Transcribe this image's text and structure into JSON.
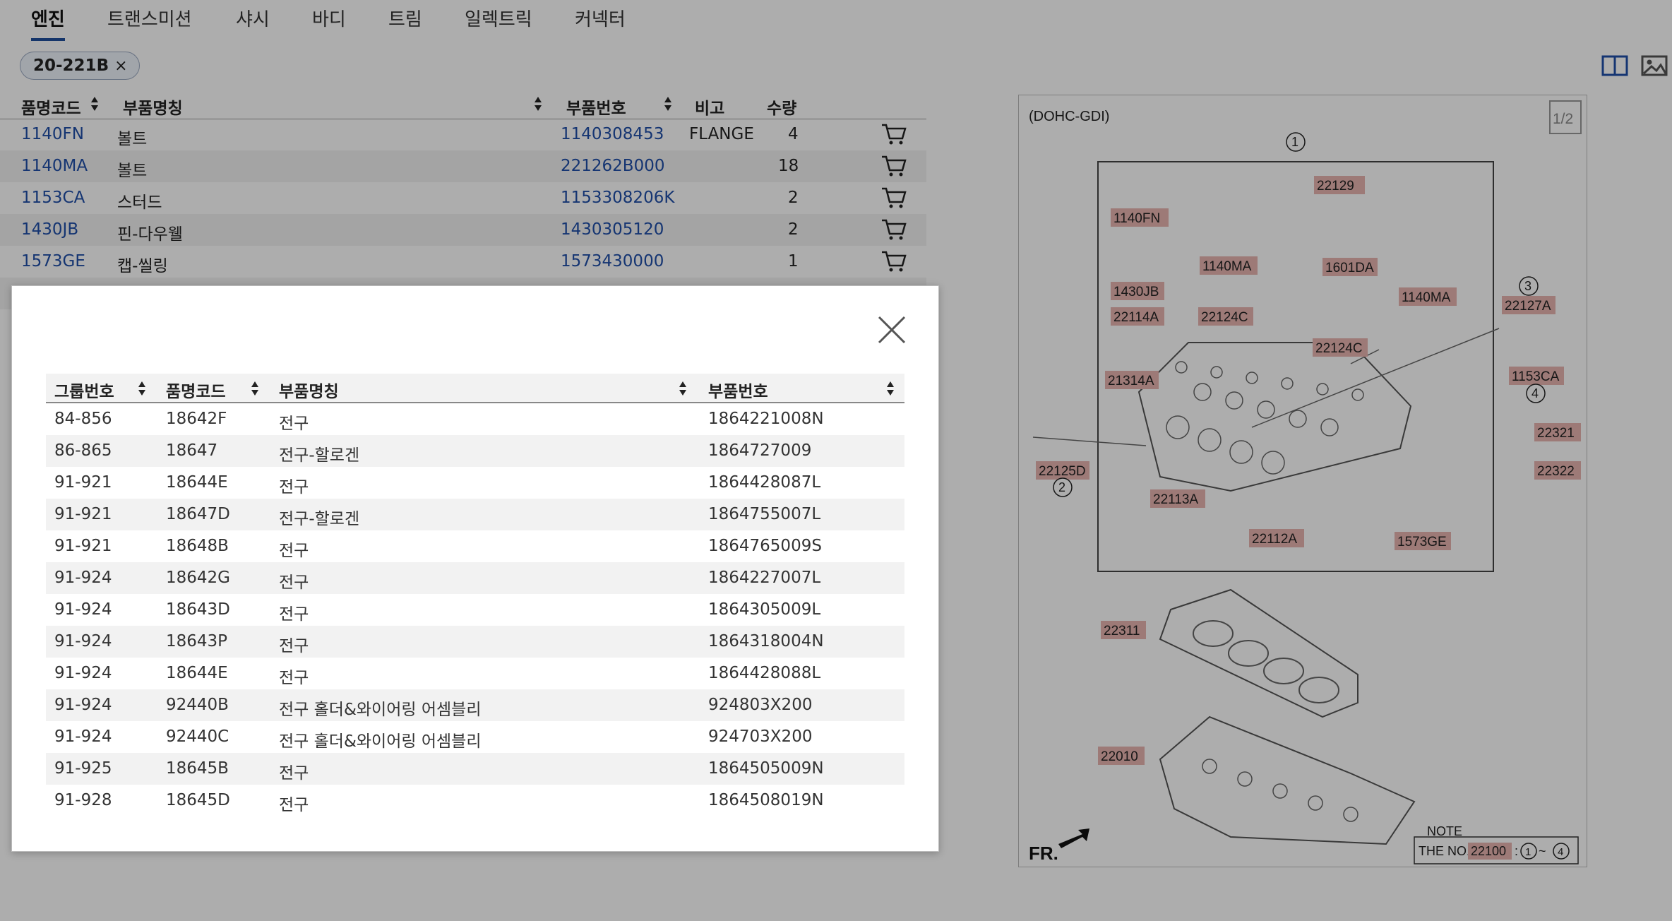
{
  "tabs": [
    "엔진",
    "트랜스미션",
    "샤시",
    "바디",
    "트림",
    "일렉트릭",
    "커넥터"
  ],
  "filter_chip": {
    "label": "20-221B",
    "remove": "×"
  },
  "parts_table": {
    "headers": {
      "code": "품명코드",
      "name": "부품명칭",
      "part_no": "부품번호",
      "note": "비고",
      "qty": "수량"
    },
    "rows": [
      {
        "code": "1140FN",
        "name": "볼트",
        "part_no": "1140308453",
        "note": "FLANGE",
        "qty": "4"
      },
      {
        "code": "1140MA",
        "name": "볼트",
        "part_no": "221262B000",
        "note": "",
        "qty": "18"
      },
      {
        "code": "1153CA",
        "name": "스터드",
        "part_no": "1153308206K",
        "note": "",
        "qty": "2"
      },
      {
        "code": "1430JB",
        "name": "핀-다우웰",
        "part_no": "1430305120",
        "note": "",
        "qty": "2"
      },
      {
        "code": "1573GE",
        "name": "캡-씰링",
        "part_no": "1573430000",
        "note": "",
        "qty": "1"
      }
    ]
  },
  "diagram": {
    "variant": "(DOHC-GDI)",
    "page": "1/2",
    "callouts": [
      "22129",
      "1140FN",
      "1140MA",
      "1601DA",
      "1140MA",
      "1430JB",
      "22114A",
      "22124C",
      "22124C",
      "22127A",
      "21314A",
      "1153CA",
      "22321",
      "22125D",
      "22322",
      "22113A",
      "22112A",
      "1573GE",
      "22311",
      "22010"
    ],
    "circle_numbers": [
      "1",
      "2",
      "3",
      "4"
    ],
    "fr_label": "FR.",
    "note_title": "NOTE",
    "note_text": "THE NO.",
    "note_part": "22100",
    "note_sep": ":",
    "note_range_sep": "~"
  },
  "modal": {
    "headers": {
      "group": "그룹번호",
      "code": "품명코드",
      "name": "부품명칭",
      "part_no": "부품번호"
    },
    "rows": [
      {
        "group": "84-856",
        "code": "18642F",
        "name": "전구",
        "part_no": "1864221008N"
      },
      {
        "group": "86-865",
        "code": "18647",
        "name": "전구-할로겐",
        "part_no": "1864727009"
      },
      {
        "group": "91-921",
        "code": "18644E",
        "name": "전구",
        "part_no": "1864428087L"
      },
      {
        "group": "91-921",
        "code": "18647D",
        "name": "전구-할로겐",
        "part_no": "1864755007L"
      },
      {
        "group": "91-921",
        "code": "18648B",
        "name": "전구",
        "part_no": "1864765009S"
      },
      {
        "group": "91-924",
        "code": "18642G",
        "name": "전구",
        "part_no": "1864227007L"
      },
      {
        "group": "91-924",
        "code": "18643D",
        "name": "전구",
        "part_no": "1864305009L"
      },
      {
        "group": "91-924",
        "code": "18643P",
        "name": "전구",
        "part_no": "1864318004N"
      },
      {
        "group": "91-924",
        "code": "18644E",
        "name": "전구",
        "part_no": "1864428088L"
      },
      {
        "group": "91-924",
        "code": "92440B",
        "name": "전구 홀더&와이어링 어셈블리",
        "part_no": "924803X200"
      },
      {
        "group": "91-924",
        "code": "92440C",
        "name": "전구 홀더&와이어링 어셈블리",
        "part_no": "924703X200"
      },
      {
        "group": "91-925",
        "code": "18645B",
        "name": "전구",
        "part_no": "1864505009N"
      },
      {
        "group": "91-928",
        "code": "18645D",
        "name": "전구",
        "part_no": "1864508019N"
      }
    ]
  }
}
